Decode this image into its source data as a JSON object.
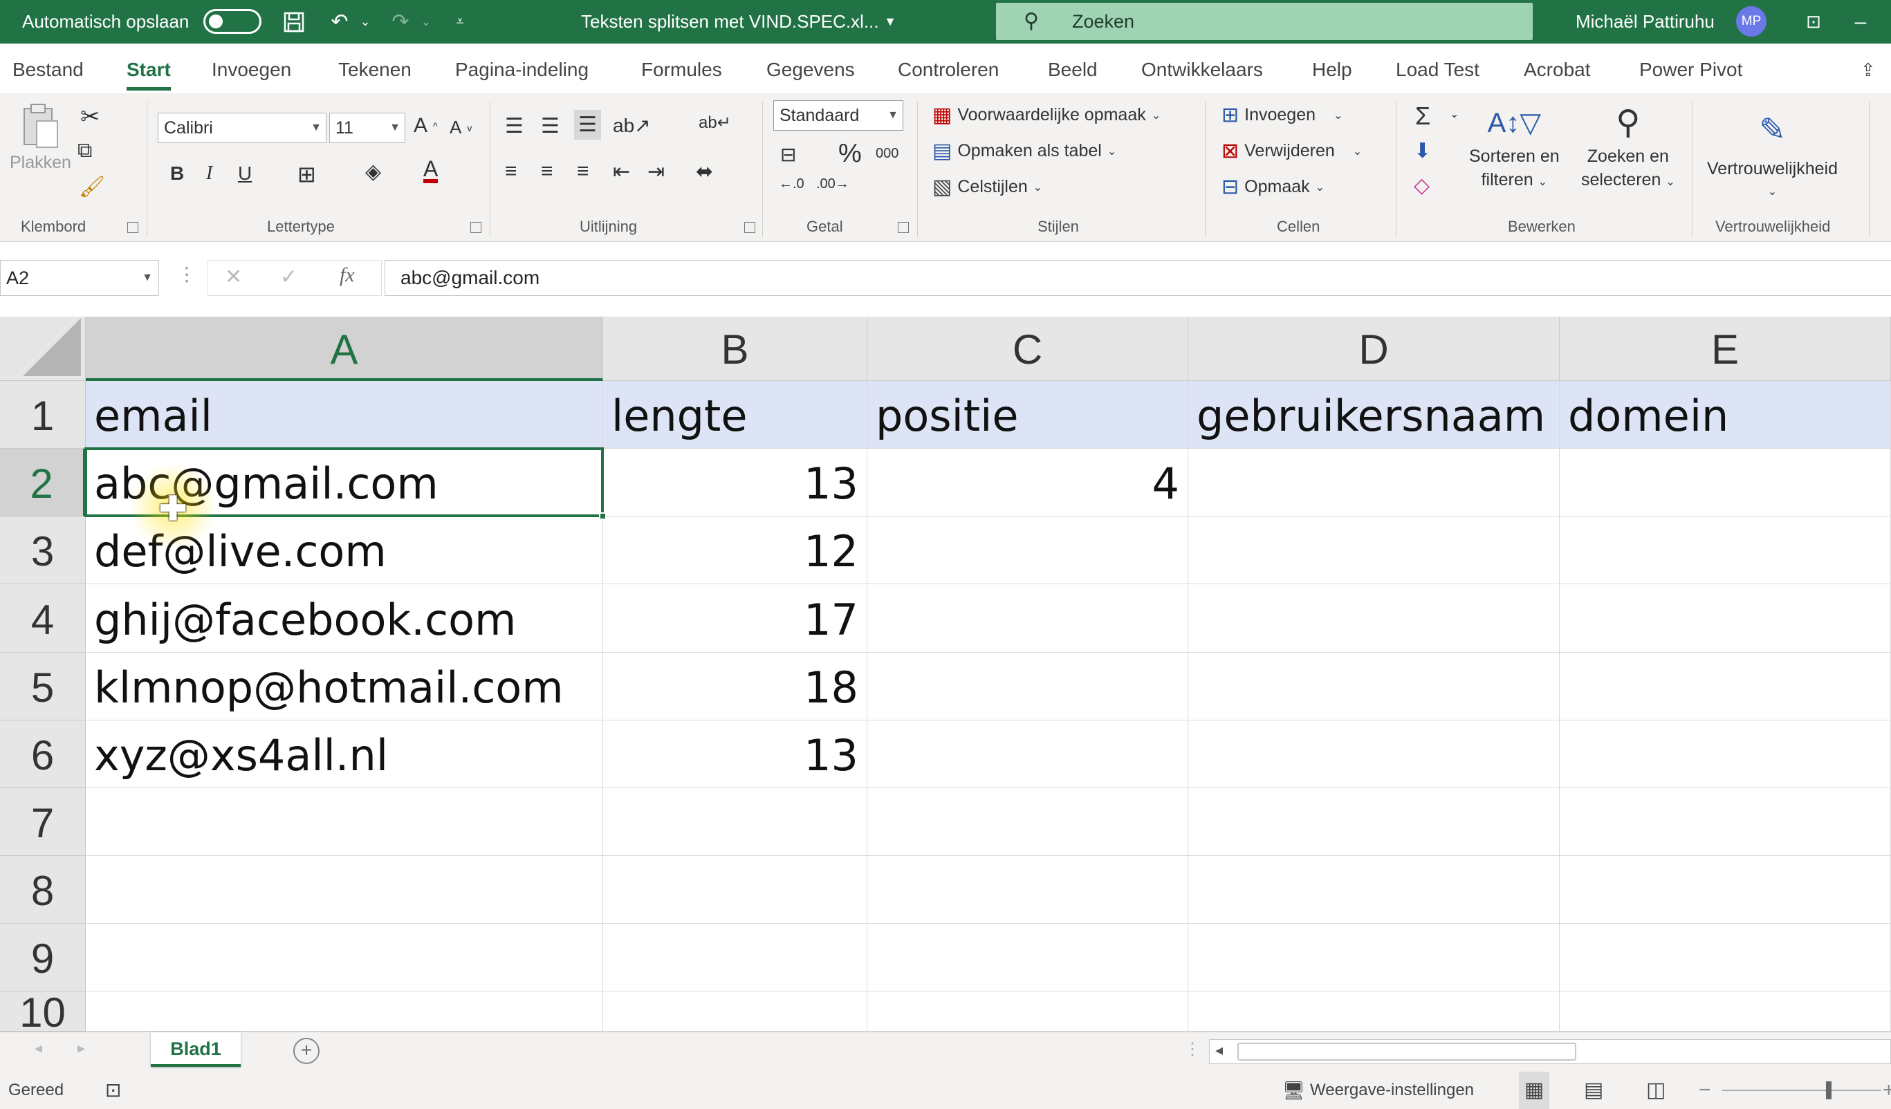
{
  "titlebar": {
    "autosave_label": "Automatisch opslaan",
    "document_title": "Teksten splitsen met VIND.SPEC.xl...",
    "search_placeholder": "Zoeken",
    "user_name": "Michaël Pattiruhu",
    "user_initials": "MP"
  },
  "tabs": [
    "Bestand",
    "Start",
    "Invoegen",
    "Tekenen",
    "Pagina-indeling",
    "Formules",
    "Gegevens",
    "Controleren",
    "Beeld",
    "Ontwikkelaars",
    "Help",
    "Load Test",
    "Acrobat",
    "Power Pivot"
  ],
  "active_tab": "Start",
  "ribbon": {
    "clipboard": {
      "paste_label": "Plakken",
      "group_label": "Klembord"
    },
    "font": {
      "font_name": "Calibri",
      "font_size": "11",
      "bold": "B",
      "italic": "I",
      "underline": "U",
      "group_label": "Lettertype"
    },
    "alignment": {
      "group_label": "Uitlijning"
    },
    "number": {
      "format": "Standaard",
      "group_label": "Getal"
    },
    "styles": {
      "conditional": "Voorwaardelijke opmaak",
      "as_table": "Opmaken als tabel",
      "cell_styles": "Celstijlen",
      "group_label": "Stijlen"
    },
    "cells": {
      "insert": "Invoegen",
      "delete": "Verwijderen",
      "format": "Opmaak",
      "group_label": "Cellen"
    },
    "editing": {
      "sort_line1": "Sorteren en",
      "sort_line2": "filteren",
      "find_line1": "Zoeken en",
      "find_line2": "selecteren",
      "group_label": "Bewerken"
    },
    "sensitivity": {
      "label": "Vertrouwelijkheid",
      "group_label": "Vertrouwelijkheid"
    }
  },
  "formula_bar": {
    "name_box": "A2",
    "content": "abc@gmail.com"
  },
  "columns": [
    "A",
    "B",
    "C",
    "D",
    "E"
  ],
  "selected_column": "A",
  "selected_row": "2",
  "row_numbers": [
    "1",
    "2",
    "3",
    "4",
    "5",
    "6",
    "7",
    "8",
    "9",
    "10"
  ],
  "rows": [
    [
      "email",
      "lengte",
      "positie",
      "gebruikersnaam",
      "domein"
    ],
    [
      "abc@gmail.com",
      "13",
      "4",
      "",
      ""
    ],
    [
      "def@live.com",
      "12",
      "",
      "",
      ""
    ],
    [
      "ghij@facebook.com",
      "17",
      "",
      "",
      ""
    ],
    [
      "klmnop@hotmail.com",
      "18",
      "",
      "",
      ""
    ],
    [
      "xyz@xs4all.nl",
      "13",
      "",
      "",
      ""
    ],
    [
      "",
      "",
      "",
      "",
      ""
    ],
    [
      "",
      "",
      "",
      "",
      ""
    ],
    [
      "",
      "",
      "",
      "",
      ""
    ],
    [
      "",
      "",
      "",
      "",
      ""
    ]
  ],
  "sheet_tab": "Blad1",
  "status": {
    "ready": "Gereed",
    "display_settings": "Weergave-instellingen"
  },
  "colors": {
    "accent": "#217346",
    "header_row": "#dde4f5",
    "search_bg": "#9fd3b4",
    "avatar": "#6b78e8"
  }
}
